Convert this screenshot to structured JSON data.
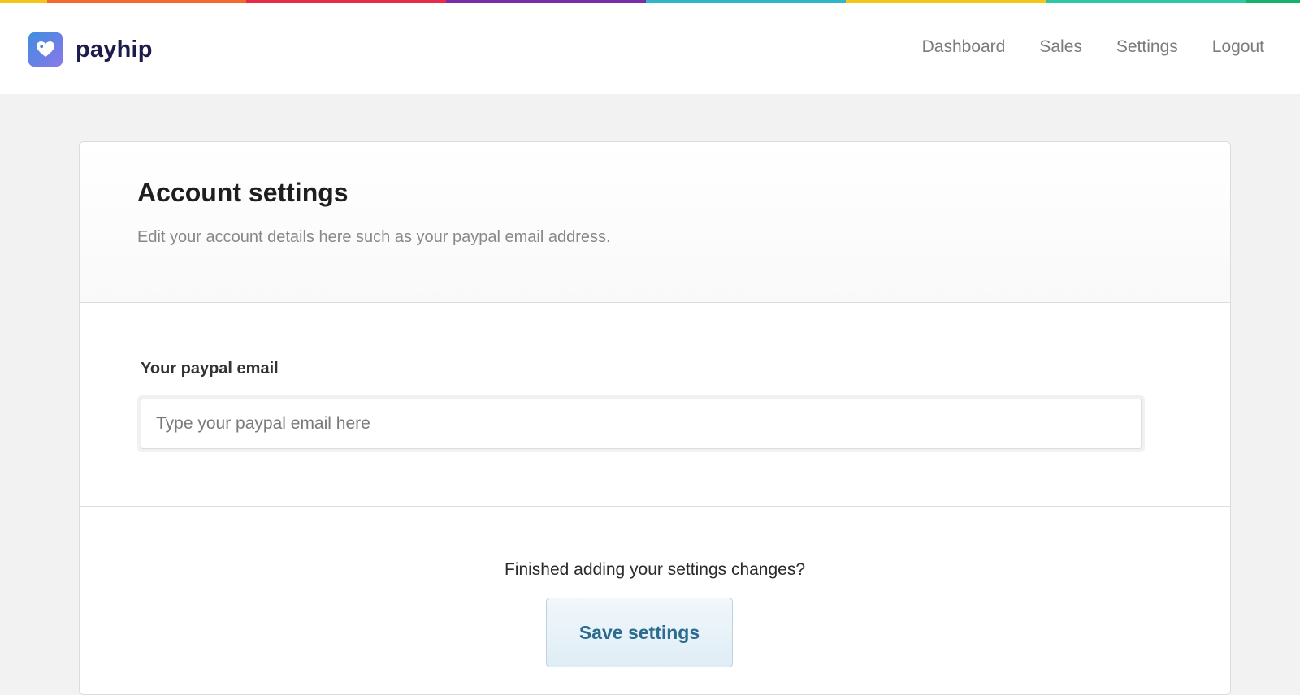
{
  "brand": {
    "name": "payhip",
    "logo_icon": "heart-tag-icon",
    "logo_colors": [
      "#3f8fe0",
      "#8b7be8"
    ]
  },
  "rainbow_colors": [
    "#f5c518",
    "#f26b2a",
    "#e8294a",
    "#7a2da8",
    "#2fb6c9",
    "#f5c518",
    "#2fc8a6",
    "#17b26a"
  ],
  "nav": {
    "items": [
      {
        "label": "Dashboard"
      },
      {
        "label": "Sales"
      },
      {
        "label": "Settings"
      },
      {
        "label": "Logout"
      }
    ]
  },
  "page": {
    "title": "Account settings",
    "subtitle": "Edit your account details here such as your paypal email address."
  },
  "form": {
    "email_label": "Your paypal email",
    "email_value": "",
    "email_placeholder": "Type your paypal email here"
  },
  "footer": {
    "prompt": "Finished adding your settings changes?",
    "save_label": "Save settings"
  },
  "colors": {
    "button_text": "#2a6b8f",
    "brand_text": "#1d1b4b",
    "page_background": "#f2f2f2"
  }
}
